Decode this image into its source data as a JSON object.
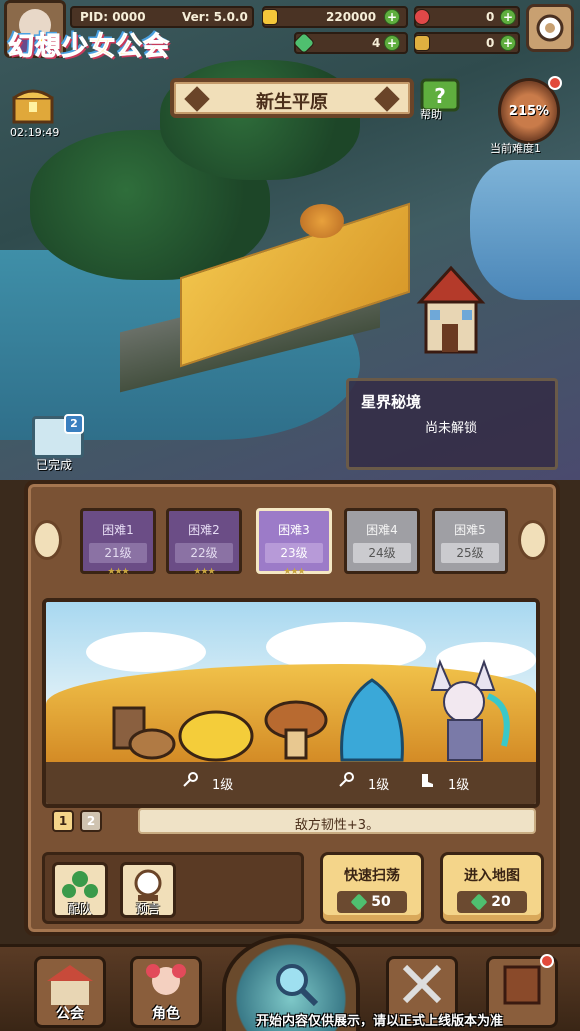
{
  "hud": {
    "pid": "PID: 0000",
    "version": "Ver: 5.0.0",
    "gold": "220000",
    "red_gem": "0",
    "clover": "4",
    "key_item": "0"
  },
  "game_logo": "幻想少女公会",
  "chest_timer": "02:19:49",
  "area_title": "新生平原",
  "help_label": "帮助",
  "difficulty": {
    "percent": "215%",
    "label": "当前难度1"
  },
  "star_realm": {
    "title": "星界秘境",
    "status": "尚未解锁"
  },
  "completed": {
    "badge": "2",
    "label": "已完成"
  },
  "difficulty_tabs": [
    {
      "name": "困难1",
      "level": "21级",
      "stars": "★★★"
    },
    {
      "name": "困难2",
      "level": "22级",
      "stars": "★★★"
    },
    {
      "name": "困难3",
      "level": "23级",
      "stars": "★★★"
    },
    {
      "name": "困难4",
      "level": "24级",
      "stars": ""
    },
    {
      "name": "困难5",
      "level": "25级",
      "stars": ""
    }
  ],
  "enemy_levels": [
    "1级",
    "1级",
    "1级"
  ],
  "page_tabs": [
    "1",
    "2"
  ],
  "effect_text": "敌方韧性+3。",
  "buttons": {
    "team": "配队",
    "prophecy": "预言",
    "quick_sweep": "快速扫荡",
    "quick_sweep_cost": "50",
    "enter_map": "进入地图",
    "enter_map_cost": "20"
  },
  "nav": {
    "guild": "公会",
    "character": "角色",
    "start": "开始"
  },
  "notice": "内容仅供展示，请以正式上线版本为准",
  "colors": {
    "panel_brown": "#7a5234",
    "selected_card": "#9c7bc8",
    "locked_card": "#9f9fa4"
  }
}
